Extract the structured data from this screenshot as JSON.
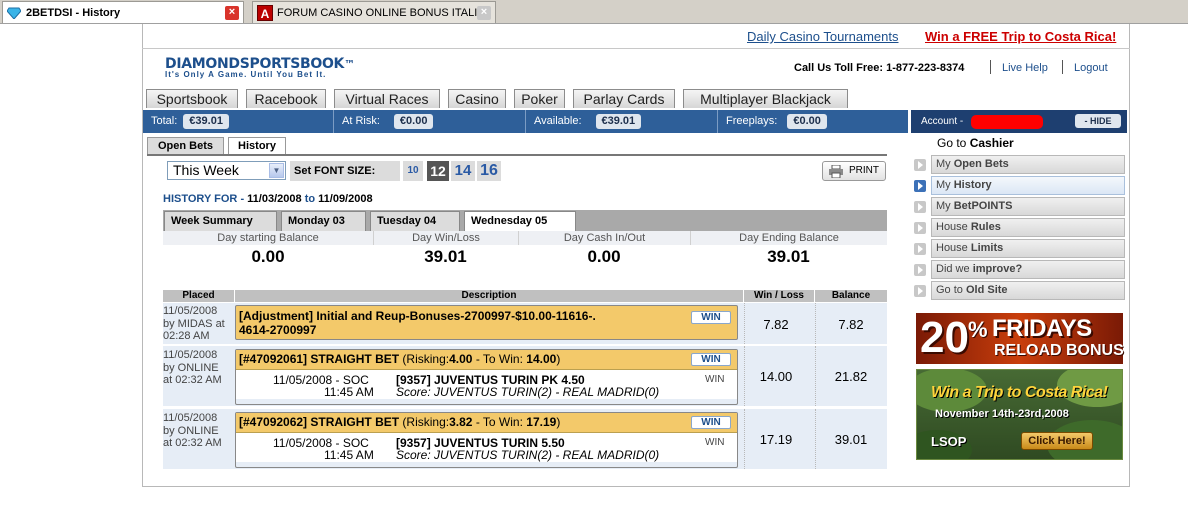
{
  "browser": {
    "tabs": [
      {
        "title": "2BETDSI - History",
        "active": true
      },
      {
        "title": "FORUM CASINO ONLINE BONUS ITALI...",
        "active": false
      }
    ]
  },
  "header": {
    "link_tournaments": "Daily Casino Tournaments",
    "link_promo": "Win a FREE Trip to Costa Rica!",
    "logo_main": "DIAMOND",
    "logo_second": "SPORTSBOOK",
    "logo_tm": "™",
    "tagline": "It's Only A Game. Until You Bet It.",
    "toll_free": "Call Us Toll Free: 1-877-223-8374",
    "live_help": "Live Help",
    "logout": "Logout"
  },
  "nav": {
    "tabs": [
      "Sportsbook",
      "Racebook",
      "Virtual Races",
      "Casino",
      "Poker",
      "Parlay Cards",
      "Multiplayer Blackjack"
    ]
  },
  "balances": [
    {
      "label": "Total:",
      "value": "€39.01"
    },
    {
      "label": "At Risk:",
      "value": "€0.00"
    },
    {
      "label": "Available:",
      "value": "€39.01"
    },
    {
      "label": "Freeplays:",
      "value": "€0.00"
    }
  ],
  "subtabs": [
    "Open Bets",
    "History"
  ],
  "controls": {
    "period": "This Week",
    "font_size_label": "Set FONT SIZE:",
    "font_sizes": [
      "10",
      "12",
      "14",
      "16"
    ],
    "selected_font_size": "12",
    "print": "PRINT"
  },
  "history_for": {
    "label": "HISTORY FOR",
    "dash": "-",
    "from": "11/03/2008",
    "to_word": "to",
    "to": "11/09/2008"
  },
  "day_tabs": [
    "Week Summary",
    "Monday 03",
    "Tuesday 04",
    "Wednesday 05"
  ],
  "summary": {
    "headers": [
      "Day starting Balance",
      "Day Win/Loss",
      "Day Cash In/Out",
      "Day Ending Balance"
    ],
    "values": [
      "0.00",
      "39.01",
      "0.00",
      "39.01"
    ]
  },
  "table": {
    "headers": [
      "Placed",
      "Description",
      "Win / Loss",
      "Balance"
    ],
    "rows": [
      {
        "placed": [
          "11/05/2008",
          "by MIDAS at",
          "02:28 AM"
        ],
        "title_bracket": "[Adjustment]",
        "title_rest": "Initial and Reup-Bonuses-2700997-$10.00-11616-.",
        "title_line2": "4614-2700997",
        "result": "WIN",
        "win_loss": "7.82",
        "balance": "7.82"
      },
      {
        "placed": [
          "11/05/2008",
          "by ONLINE",
          "at 02:32 AM"
        ],
        "title_bracket": "[#47092061]",
        "title_rest": "STRAIGHT BET",
        "risking_label": "(Risking:",
        "risking": "4.00",
        "to_win_label": "- To Win:",
        "to_win": "14.00",
        "close": ")",
        "result": "WIN",
        "date_sport": "11/05/2008 - SOC",
        "time": "11:45 AM",
        "selection": "[9357] JUVENTUS TURIN PK 4.50",
        "score": "Score: JUVENTUS TURIN(2) - REAL MADRID(0)",
        "line_result": "WIN",
        "win_loss": "14.00",
        "balance": "21.82"
      },
      {
        "placed": [
          "11/05/2008",
          "by ONLINE",
          "at 02:32 AM"
        ],
        "title_bracket": "[#47092062]",
        "title_rest": "STRAIGHT BET",
        "risking_label": "(Risking:",
        "risking": "3.82",
        "to_win_label": "- To Win:",
        "to_win": "17.19",
        "close": ")",
        "result": "WIN",
        "date_sport": "11/05/2008 - SOC",
        "time": "11:45 AM",
        "selection": "[9357] JUVENTUS TURIN 5.50",
        "score": "Score: JUVENTUS TURIN(2) - REAL MADRID(0)",
        "line_result": "WIN",
        "win_loss": "17.19",
        "balance": "39.01"
      }
    ]
  },
  "account_panel": {
    "account_label": "Account -",
    "hide": "- HIDE",
    "goto": "Go to",
    "cashier": "Cashier",
    "menu": [
      {
        "a": "My ",
        "b": "Open Bets"
      },
      {
        "a": "My ",
        "b": "History"
      },
      {
        "a": "My ",
        "b": "BetPOINTS"
      },
      {
        "a": "House ",
        "b": "Rules"
      },
      {
        "a": "House ",
        "b": "Limits"
      },
      {
        "a": "Did we ",
        "b": "improve?"
      },
      {
        "a": "Go to ",
        "b": "Old Site"
      }
    ]
  },
  "banners": {
    "fridays_pct": "20",
    "fridays_sign": "%",
    "fridays_l1": "FRIDAYS",
    "fridays_l2": "RELOAD BONUS",
    "trip_l1": "Win a Trip to Costa Rica!",
    "trip_dates": "November 14th-23rd,2008",
    "trip_logo": "LSOP",
    "trip_cta": "Click Here!"
  },
  "colors": {
    "accent_blue": "#2e5f99",
    "promo_red": "#cc0000",
    "bet_yellow": "#f3c96a"
  }
}
